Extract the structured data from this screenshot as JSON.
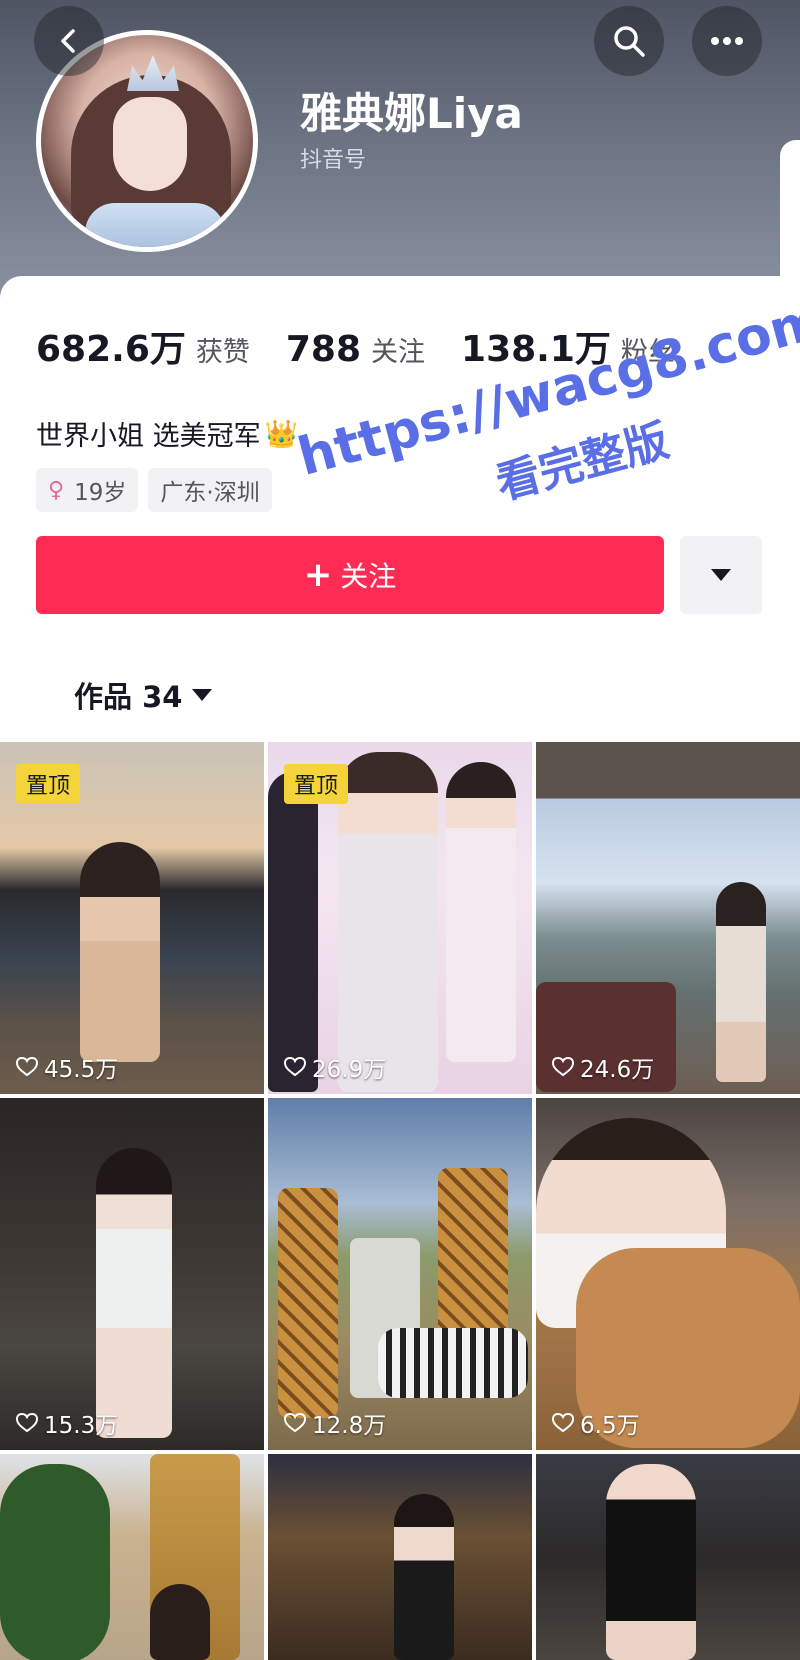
{
  "header": {
    "name": "雅典娜Liya",
    "douyin_id_label": "抖音号",
    "back_icon": "chevron-left-icon",
    "search_icon": "search-icon",
    "more_icon": "more-icon"
  },
  "stats": [
    {
      "value": "682.6万",
      "label": "获赞"
    },
    {
      "value": "788",
      "label": "关注"
    },
    {
      "value": "138.1万",
      "label": "粉丝"
    }
  ],
  "bio": {
    "text": "世界小姐 选美冠军",
    "emoji": "👑"
  },
  "tags": {
    "age": "19岁",
    "location": "广东·深圳"
  },
  "follow_button": {
    "label": "关注",
    "color": "#fe2c55"
  },
  "works": {
    "label": "作品 34"
  },
  "watermark": {
    "line1": "https://wacg8.com",
    "line2": "看完整版"
  },
  "videos": [
    {
      "pinned": true,
      "pin_label": "置顶",
      "likes": "45.5万"
    },
    {
      "pinned": true,
      "pin_label": "置顶",
      "likes": "26.9万"
    },
    {
      "pinned": false,
      "likes": "24.6万"
    },
    {
      "pinned": false,
      "likes": "15.3万"
    },
    {
      "pinned": false,
      "likes": "12.8万"
    },
    {
      "pinned": false,
      "likes": "6.5万"
    },
    {
      "pinned": false,
      "likes": ""
    },
    {
      "pinned": false,
      "likes": ""
    },
    {
      "pinned": false,
      "likes": ""
    }
  ]
}
